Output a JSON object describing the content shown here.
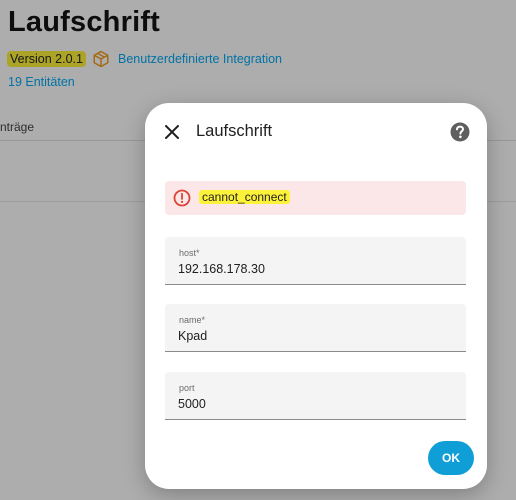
{
  "page": {
    "title": "Laufschrift",
    "version": "Version 2.0.1",
    "integration_label": "Benutzerdefinierte Integration",
    "entities_link": "19 Entitäten",
    "entries_label": "nträge"
  },
  "dialog": {
    "title": "Laufschrift",
    "error_message": "cannot_connect",
    "fields": [
      {
        "label": "host*",
        "value": "192.168.178.30"
      },
      {
        "label": "name*",
        "value": "Kpad"
      },
      {
        "label": "port",
        "value": "5000"
      }
    ],
    "ok_label": "OK"
  },
  "colors": {
    "accent": "#03a9f4",
    "ok_button": "#0f9fd6",
    "error_background": "#fbe7e7",
    "error_icon": "#db4437",
    "highlight": "#fdf23a",
    "integration_icon": "#f09c1e"
  },
  "icons": {
    "close": "close-icon",
    "help": "help-circle-icon",
    "error": "alert-circle-icon",
    "integration": "package-icon"
  }
}
